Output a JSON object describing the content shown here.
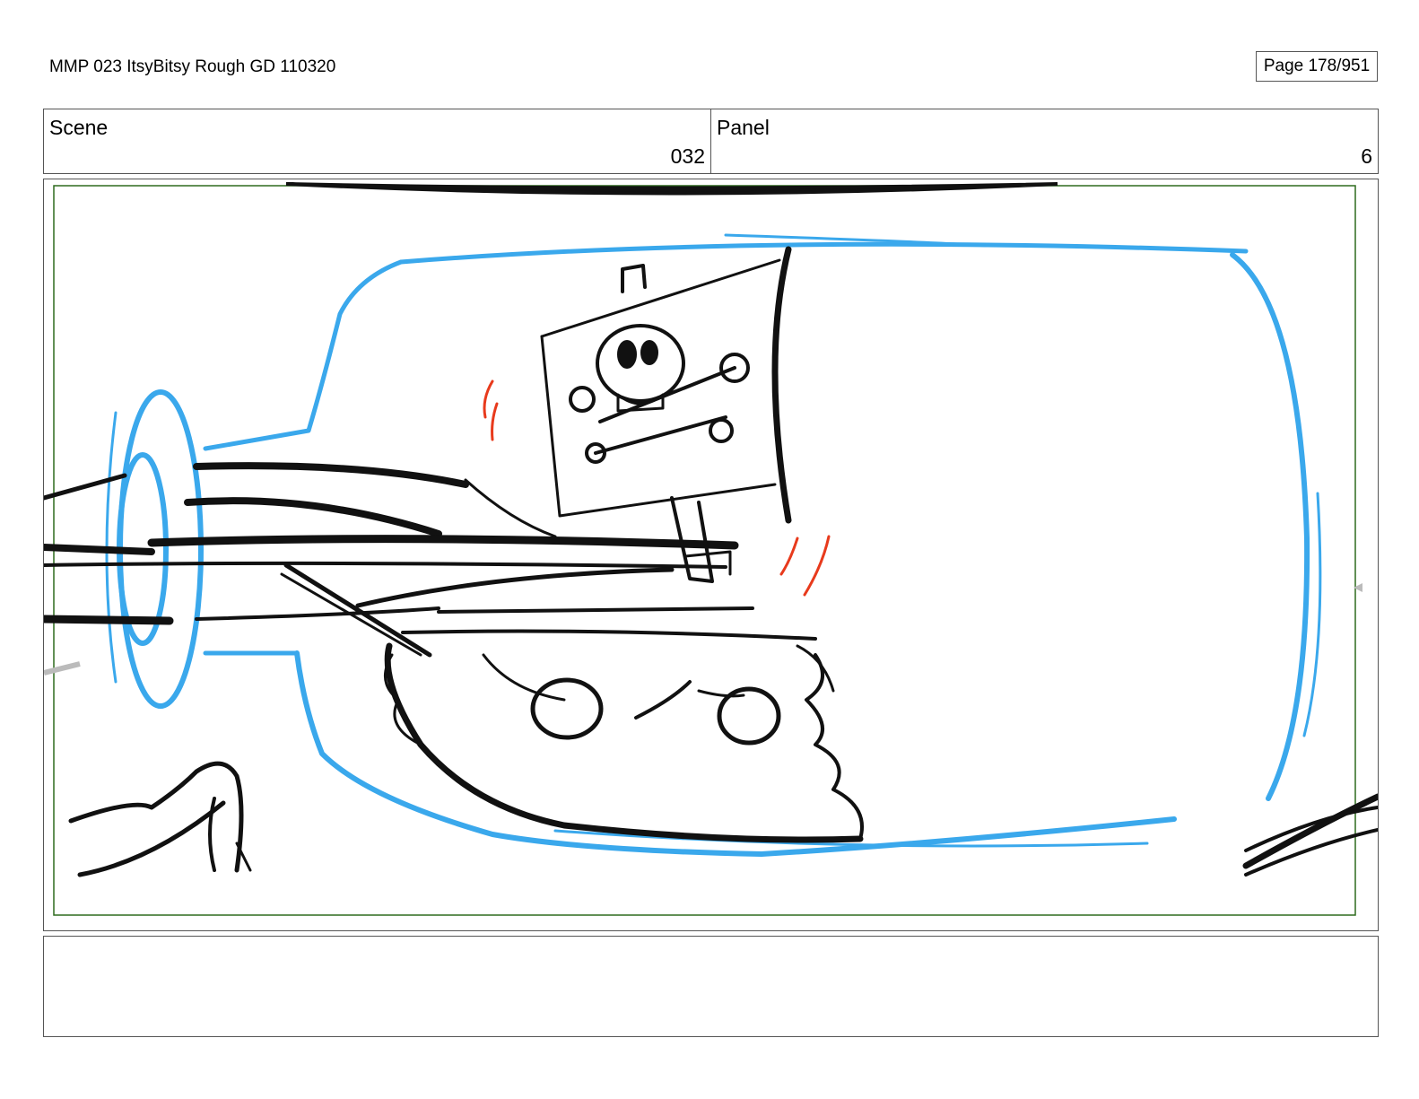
{
  "header": {
    "title": "MMP 023 ItsyBitsy Rough GD 110320",
    "page": "Page 178/951"
  },
  "info": {
    "scene_label": "Scene",
    "scene_value": "032",
    "panel_label": "Panel",
    "panel_value": "6"
  },
  "panel": {
    "colors": {
      "bottle_outline": "#3aa8ec",
      "ink": "#111111",
      "motion_marks": "#e83a1c",
      "safe_frame": "#2e6b1e"
    },
    "icons": [
      "bottle-drawing",
      "pirate-ship-drawing",
      "skull-and-crossbones-flag-icon"
    ]
  },
  "notes": {
    "text": ""
  }
}
